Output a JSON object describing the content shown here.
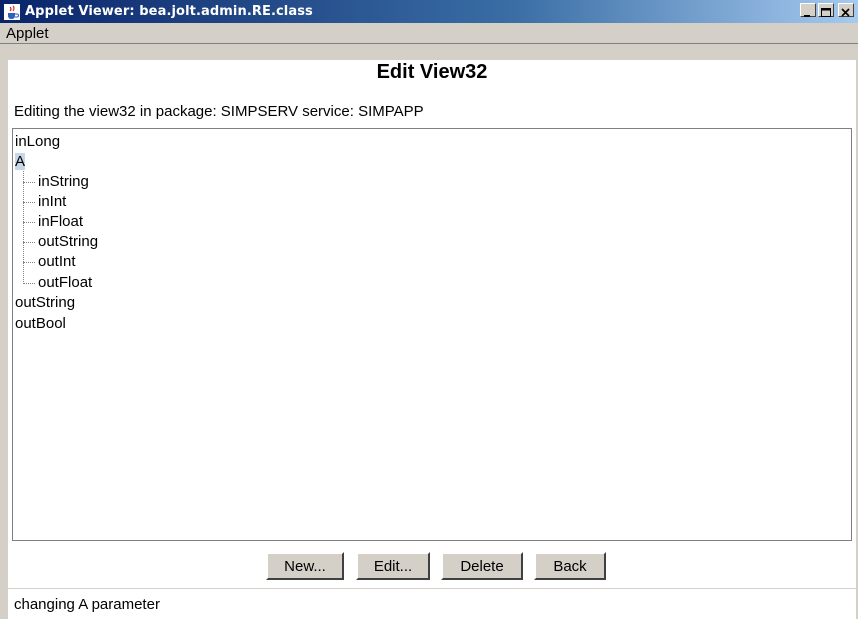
{
  "window": {
    "title": "Applet Viewer: bea.jolt.admin.RE.class",
    "icon": "java-cup-icon",
    "controls": [
      "minimize-icon",
      "maximize-icon",
      "close-icon"
    ]
  },
  "menubar": {
    "items": [
      "Applet"
    ]
  },
  "main": {
    "heading": "Edit View32",
    "subtitle": "Editing the view32 in package: SIMPSERV service: SIMPAPP"
  },
  "tree": {
    "items": [
      {
        "label": "inLong",
        "level": 0
      },
      {
        "label": "A",
        "level": 0,
        "selected": true
      },
      {
        "label": "inString",
        "level": 1
      },
      {
        "label": "inInt",
        "level": 1
      },
      {
        "label": "inFloat",
        "level": 1
      },
      {
        "label": "outString",
        "level": 1
      },
      {
        "label": "outInt",
        "level": 1
      },
      {
        "label": "outFloat",
        "level": 1
      },
      {
        "label": "outString",
        "level": 0
      },
      {
        "label": "outBool",
        "level": 0
      }
    ],
    "selection_color": "#c7d7ea"
  },
  "buttons": {
    "new_label": "New...",
    "edit_label": "Edit...",
    "delete_label": "Delete",
    "back_label": "Back"
  },
  "status": {
    "text": "changing A parameter"
  }
}
